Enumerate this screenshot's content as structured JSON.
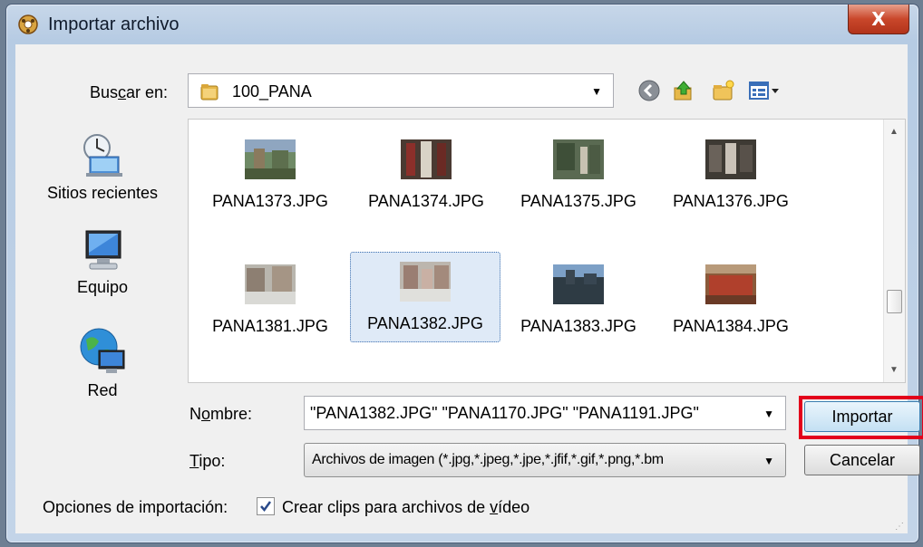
{
  "window": {
    "title": "Importar archivo",
    "close_label": "X"
  },
  "lookin": {
    "label_pre": "Bus",
    "label_u": "c",
    "label_post": "ar en:",
    "path": "100_PANA"
  },
  "places": [
    {
      "label": "Sitios recientes"
    },
    {
      "label": "Equipo"
    },
    {
      "label": "Red"
    }
  ],
  "files": [
    {
      "name": "PANA1373.JPG"
    },
    {
      "name": "PANA1374.JPG"
    },
    {
      "name": "PANA1375.JPG"
    },
    {
      "name": "PANA1376.JPG"
    },
    {
      "name": "PANA1381.JPG"
    },
    {
      "name": "PANA1382.JPG"
    },
    {
      "name": "PANA1383.JPG"
    },
    {
      "name": "PANA1384.JPG"
    }
  ],
  "name_field": {
    "label_pre": "N",
    "label_u": "o",
    "label_post": "mbre:",
    "value": "\"PANA1382.JPG\" \"PANA1170.JPG\" \"PANA1191.JPG\""
  },
  "type_field": {
    "label_u": "T",
    "label_post": "ipo:",
    "value": "Archivos de imagen (*.jpg,*.jpeg,*.jpe,*.jfif,*.gif,*.png,*.bm"
  },
  "buttons": {
    "import": "Importar",
    "cancel": "Cancelar"
  },
  "options": {
    "label": "Opciones de importación:",
    "checkbox_pre": "Crear clips para archivos de ",
    "checkbox_u": "v",
    "checkbox_post": "ídeo",
    "checked": true
  },
  "colors": {
    "highlight": "#e3001b",
    "selection": "#dfeaf7"
  },
  "icons": {
    "back": "back-icon",
    "up": "up-folder-icon",
    "new_folder": "new-folder-icon",
    "view": "view-menu-icon"
  }
}
